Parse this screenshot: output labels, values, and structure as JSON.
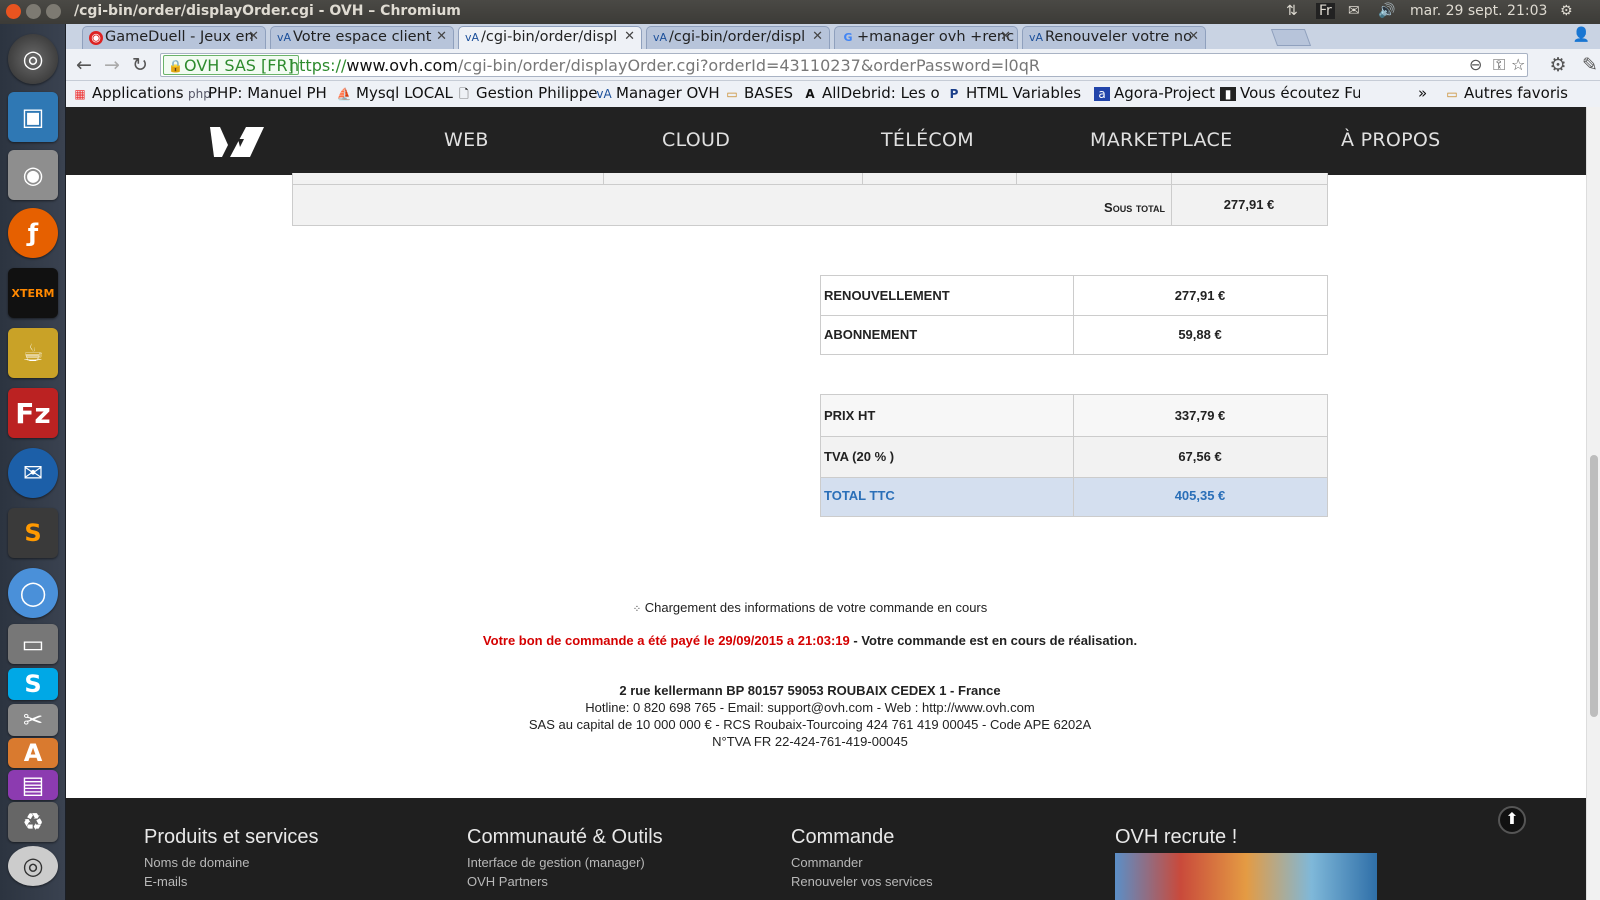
{
  "os": {
    "window_title": "/cgi-bin/order/displayOrder.cgi - OVH – Chromium",
    "keyboard_layout": "Fr",
    "clock": "mar. 29 sept. 21:03"
  },
  "launcher": {
    "apps": [
      "dash-icon",
      "image-viewer-icon",
      "camera-icon",
      "firefox-icon",
      "xterm-icon",
      "teapot-icon",
      "filezilla-icon",
      "thunderbird-icon",
      "sublime-icon",
      "chromium-icon",
      "scanner-icon",
      "skype-icon",
      "tools-icon",
      "software-center-icon",
      "archive-icon",
      "dvd-icon"
    ]
  },
  "tabs": [
    {
      "label": "GameDuell - Jeux en",
      "icon": "gameduell-icon",
      "active": false
    },
    {
      "label": "Votre espace client",
      "icon": "ovh-icon",
      "active": false
    },
    {
      "label": "/cgi-bin/order/displ",
      "icon": "ovh-icon",
      "active": true
    },
    {
      "label": "/cgi-bin/order/displ",
      "icon": "ovh-icon",
      "active": false
    },
    {
      "label": "+manager ovh +renc",
      "icon": "google-icon",
      "active": false
    },
    {
      "label": "Renouveler votre no",
      "icon": "ovh-icon",
      "active": false
    }
  ],
  "toolbar": {
    "ev_label": "OVH SAS [FR]",
    "url_scheme": "https://",
    "url_host": "www.ovh.com",
    "url_path": "/cgi-bin/order/displayOrder.cgi?orderId=43110237&orderPassword=l0qR"
  },
  "bookmarks": {
    "items": [
      {
        "label": "Applications",
        "icon": "apps-grid-icon"
      },
      {
        "label": "PHP: Manuel PHF",
        "icon": "php-icon"
      },
      {
        "label": "Mysql LOCAL",
        "icon": "phpmyadmin-icon"
      },
      {
        "label": "Gestion Philippe",
        "icon": "page-icon"
      },
      {
        "label": "Manager OVH",
        "icon": "ovh-icon"
      },
      {
        "label": "BASES",
        "icon": "folder-icon"
      },
      {
        "label": "AllDebrid: Les off",
        "icon": "alldebrid-icon"
      },
      {
        "label": "HTML Variables f",
        "icon": "paypal-icon"
      },
      {
        "label": "Agora-Project",
        "icon": "agora-icon"
      },
      {
        "label": "Vous écoutez Fur",
        "icon": "radio-icon"
      }
    ],
    "overflow": "»",
    "other_label": "Autres favoris"
  },
  "ovh_nav": {
    "items": [
      "WEB",
      "CLOUD",
      "TÉLÉCOM",
      "MARKETPLACE",
      "À PROPOS"
    ]
  },
  "order": {
    "subtotal_label": "Sous total",
    "subtotal_value": "277,91 €",
    "lines": [
      {
        "label": "RENOUVELLEMENT",
        "value": "277,91 €"
      },
      {
        "label": "ABONNEMENT",
        "value": "59,88 €"
      }
    ],
    "totals": [
      {
        "label": "PRIX HT",
        "value": "337,79 €"
      },
      {
        "label": "TVA (20 % )",
        "value": "67,56 €"
      },
      {
        "label": "TOTAL TTC",
        "value": "405,35 €"
      }
    ],
    "loading_text": "Chargement des informations de votre commande en cours",
    "paid_text": "Votre bon de commande a été payé le 29/09/2015 a 21:03:19",
    "status_text": " - Votre commande est en cours de réalisation."
  },
  "company": {
    "address": "2 rue kellermann BP 80157 59053 ROUBAIX CEDEX 1 - France",
    "contact": "Hotline: 0 820 698 765 - Email: support@ovh.com - Web : http://www.ovh.com",
    "legal": "SAS au capital de 10 000 000 € - RCS Roubaix-Tourcoing 424 761 419 00045 - Code APE 6202A",
    "vat": "N°TVA FR 22-424-761-419-00045"
  },
  "footer": {
    "columns": [
      {
        "title": "Produits et services",
        "links": [
          "Noms de domaine",
          "E-mails"
        ]
      },
      {
        "title": "Communauté & Outils",
        "links": [
          "Interface de gestion (manager)",
          "OVH Partners"
        ]
      },
      {
        "title": "Commande",
        "links": [
          "Commander",
          "Renouveler vos services"
        ]
      },
      {
        "title": "OVH recrute !",
        "links": []
      }
    ]
  },
  "colors": {
    "total_bg": "#d4dfef",
    "total_text": "#2a6fb8",
    "paid_red": "#d40000",
    "nav_bg": "#222222"
  }
}
